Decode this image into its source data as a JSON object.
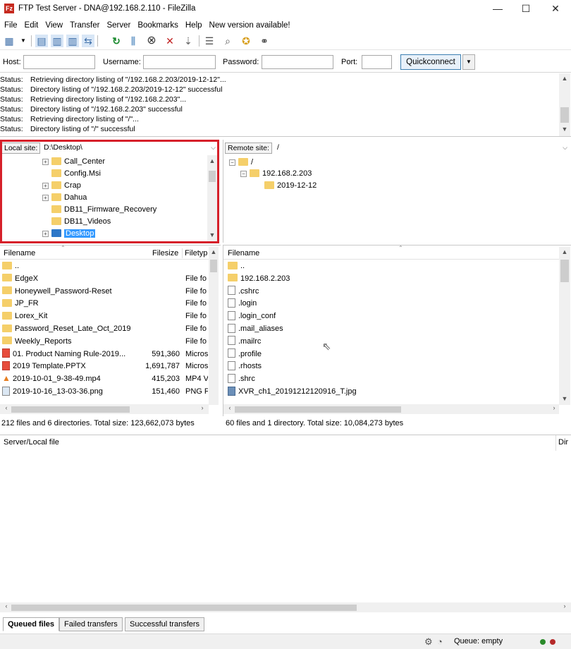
{
  "window": {
    "title": "FTP Test Server - DNA@192.168.2.110 - FileZilla",
    "minimize": "—",
    "maximize": "☐",
    "close": "✕"
  },
  "menu": [
    "File",
    "Edit",
    "View",
    "Transfer",
    "Server",
    "Bookmarks",
    "Help",
    "New version available!"
  ],
  "quickconnect": {
    "host_label": "Host:",
    "username_label": "Username:",
    "password_label": "Password:",
    "port_label": "Port:",
    "host_value": "",
    "username_value": "",
    "password_value": "",
    "port_value": "",
    "button": "Quickconnect",
    "dropdown": "▼"
  },
  "log": [
    {
      "k": "Status:",
      "v": "Retrieving directory listing of \"/192.168.2.203/2019-12-12\"..."
    },
    {
      "k": "Status:",
      "v": "Directory listing of \"/192.168.2.203/2019-12-12\" successful"
    },
    {
      "k": "Status:",
      "v": "Retrieving directory listing of \"/192.168.2.203\"..."
    },
    {
      "k": "Status:",
      "v": "Directory listing of \"/192.168.2.203\" successful"
    },
    {
      "k": "Status:",
      "v": "Retrieving directory listing of \"/\"..."
    },
    {
      "k": "Status:",
      "v": "Directory listing of \"/\" successful"
    }
  ],
  "local": {
    "site_label": "Local site:",
    "path": "D:\\Desktop\\",
    "tree": [
      "Call_Center",
      "Config.Msi",
      "Crap",
      "Dahua",
      "DB11_Firmware_Recovery",
      "DB11_Videos",
      "Desktop"
    ],
    "headers": {
      "name": "Filename",
      "size": "Filesize",
      "type": "Filetyp"
    },
    "files": [
      {
        "name": "..",
        "size": "",
        "type": ""
      },
      {
        "name": "EdgeX",
        "size": "",
        "type": "File fo"
      },
      {
        "name": "Honeywell_Password-Reset",
        "size": "",
        "type": "File fo"
      },
      {
        "name": "JP_FR",
        "size": "",
        "type": "File fo"
      },
      {
        "name": "Lorex_Kit",
        "size": "",
        "type": "File fo"
      },
      {
        "name": "Password_Reset_Late_Oct_2019",
        "size": "",
        "type": "File fo"
      },
      {
        "name": "Weekly_Reports",
        "size": "",
        "type": "File fo"
      },
      {
        "name": "01. Product Naming Rule-2019...",
        "size": "591,360",
        "type": "Micros"
      },
      {
        "name": "2019 Template.PPTX",
        "size": "1,691,787",
        "type": "Micros"
      },
      {
        "name": "2019-10-01_9-38-49.mp4",
        "size": "415,203",
        "type": "MP4 V"
      },
      {
        "name": "2019-10-16_13-03-36.png",
        "size": "151,460",
        "type": "PNG F"
      }
    ],
    "status": "212 files and 6 directories. Total size: 123,662,073 bytes"
  },
  "remote": {
    "site_label": "Remote site:",
    "path": "/",
    "tree": [
      "/",
      "192.168.2.203",
      "2019-12-12"
    ],
    "headers": {
      "name": "Filename"
    },
    "files": [
      "..",
      "192.168.2.203",
      ".cshrc",
      ".login",
      ".login_conf",
      ".mail_aliases",
      ".mailrc",
      ".profile",
      ".rhosts",
      ".shrc",
      "XVR_ch1_20191212120916_T.jpg"
    ],
    "status": "60 files and 1 directory. Total size: 10,084,273 bytes"
  },
  "queue": {
    "col1": "Server/Local file",
    "col2": "Dir",
    "tabs": [
      "Queued files",
      "Failed transfers",
      "Successful transfers"
    ]
  },
  "statusbar": {
    "queue": "Queue: empty"
  },
  "colors": {
    "highlight": "#d6202a",
    "selection": "#3399ff",
    "folder": "#f5cf6a"
  }
}
